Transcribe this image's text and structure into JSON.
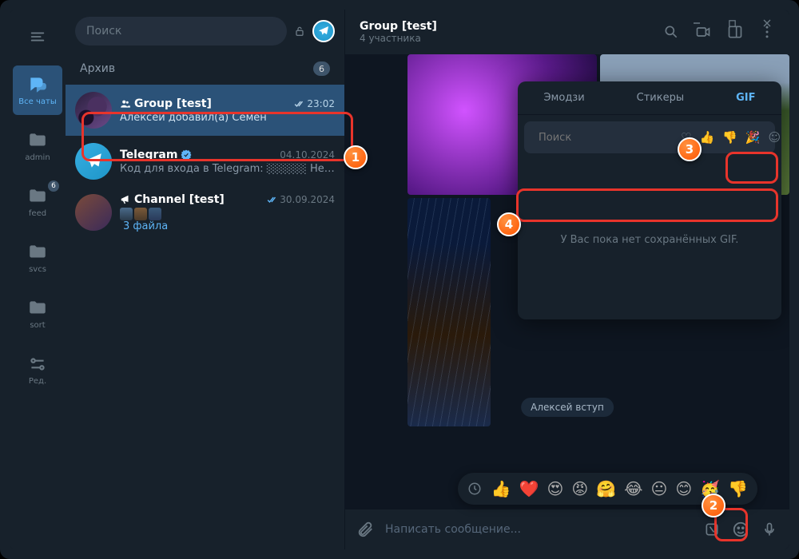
{
  "titlebar": {},
  "rail": {
    "items": [
      {
        "label": "Все чаты",
        "icon": "chats",
        "active": true
      },
      {
        "label": "admin",
        "icon": "folder"
      },
      {
        "label": "feed",
        "icon": "folder",
        "badge": "6"
      },
      {
        "label": "svcs",
        "icon": "folder"
      },
      {
        "label": "sort",
        "icon": "folder"
      },
      {
        "label": "Ред.",
        "icon": "edit"
      }
    ]
  },
  "search": {
    "placeholder": "Поиск"
  },
  "archive": {
    "label": "Архив",
    "count": "6"
  },
  "chats": [
    {
      "name": "Group [test]",
      "message": "Алексей добавил(а) Семён",
      "time": "23:02",
      "checks": true,
      "group": true,
      "selected": true
    },
    {
      "name": "Telegram",
      "message": "Код для входа в Telegram: ░░░░░ Не давайт...",
      "time": "04.10.2024",
      "verified": true
    },
    {
      "name": "Channel [test]",
      "message": "3 файла",
      "time": "30.09.2024",
      "checks": true,
      "channel": true,
      "files": true
    }
  ],
  "chat_header": {
    "title": "Group [test]",
    "subtitle": "4 участника"
  },
  "service": "Алексей вступ",
  "popup": {
    "tabs": [
      "Эмодзи",
      "Стикеры",
      "GIF"
    ],
    "active_tab": 2,
    "search_placeholder": "Поиск",
    "empty_text": "У Вас пока нет сохранённых GIF."
  },
  "emoji_strip": [
    "👍",
    "❤️",
    "😍",
    "😡",
    "🤗",
    "😂",
    "😐",
    "😊",
    "🥳",
    "👎"
  ],
  "compose": {
    "placeholder": "Написать сообщение..."
  },
  "annotations": {
    "1": "1",
    "2": "2",
    "3": "3",
    "4": "4"
  }
}
